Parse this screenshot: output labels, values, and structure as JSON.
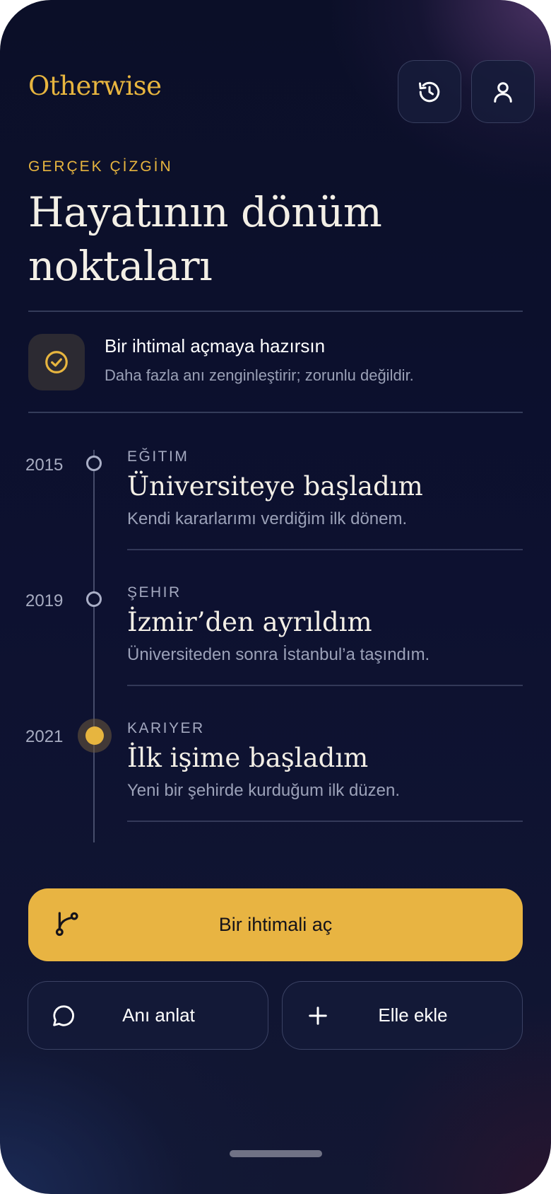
{
  "header": {
    "brand": "Otherwise",
    "history_icon": "history-icon",
    "profile_icon": "user-icon"
  },
  "section_label": "GERÇEK ÇİZGİN",
  "title_line1": "Hayatının dönüm",
  "title_line2": "noktaları",
  "status": {
    "icon": "check-circle-icon",
    "title": "Bir ihtimal açmaya hazırsın",
    "subtitle": "Daha fazla anı zenginleştirir; zorunlu değildir."
  },
  "timeline": [
    {
      "year": "2015",
      "category": "EĞITIM",
      "title": "Üniversiteye başladım",
      "description": "Kendi kararlarımı verdiğim ilk dönem.",
      "active": false
    },
    {
      "year": "2019",
      "category": "ŞEHIR",
      "title": "İzmir’den ayrıldım",
      "description": "Üniversiteden sonra İstanbul’a taşındım.",
      "active": false
    },
    {
      "year": "2021",
      "category": "KARIYER",
      "title": "İlk işime başladım",
      "description": "Yeni bir şehirde kurduğum ilk düzen.",
      "active": true
    }
  ],
  "actions": {
    "primary_label": "Bir ihtimali aç",
    "primary_icon": "branch-icon",
    "story_label": "Anı anlat",
    "story_icon": "chat-bubble-icon",
    "add_label": "Elle ekle",
    "add_icon": "plus-icon"
  },
  "colors": {
    "accent": "#e7b53f",
    "background": "#0d1130",
    "muted_text": "#9ba1b8"
  }
}
